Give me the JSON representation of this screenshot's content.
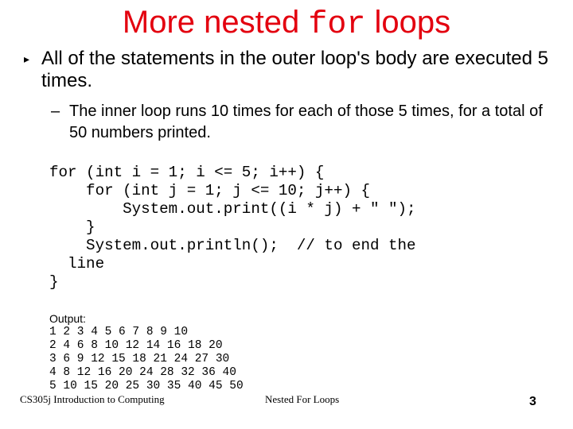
{
  "slide": {
    "title_prefix": "More nested ",
    "title_code": "for",
    "title_suffix": " loops",
    "title_color": "#e3000f",
    "bullets": [
      {
        "marker": "▸",
        "text": "All of the statements in the outer loop's body are executed 5 times."
      },
      {
        "marker": "–",
        "text": "The inner loop runs 10 times for each of those 5 times, for a total of 50 numbers printed."
      }
    ],
    "code": "for (int i = 1; i <= 5; i++) {\n    for (int j = 1; j <= 10; j++) {\n        System.out.print((i * j) + \" \");\n    }\n    System.out.println();  // to end the\n  line\n}",
    "output_label": "Output:",
    "output_lines": "1 2 3 4 5 6 7 8 9 10\n2 4 6 8 10 12 14 16 18 20\n3 6 9 12 15 18 21 24 27 30\n4 8 12 16 20 24 28 32 36 40\n5 10 15 20 25 30 35 40 45 50"
  },
  "footer": {
    "course": "CS305j Introduction to Computing",
    "topic": "Nested For Loops",
    "page_number": "3"
  }
}
